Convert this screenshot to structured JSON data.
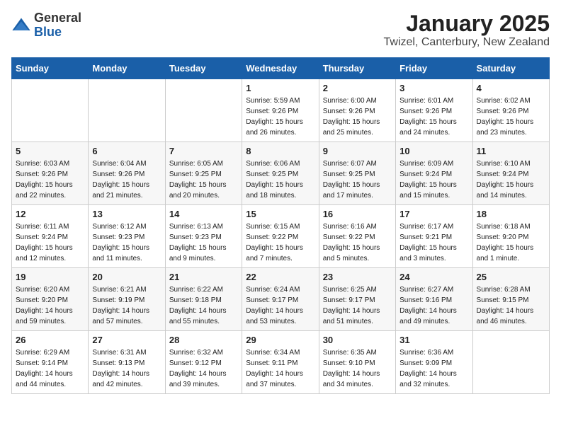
{
  "logo": {
    "general": "General",
    "blue": "Blue"
  },
  "title": "January 2025",
  "subtitle": "Twizel, Canterbury, New Zealand",
  "days_of_week": [
    "Sunday",
    "Monday",
    "Tuesday",
    "Wednesday",
    "Thursday",
    "Friday",
    "Saturday"
  ],
  "weeks": [
    [
      {
        "day": null,
        "sunrise": null,
        "sunset": null,
        "daylight": null
      },
      {
        "day": null,
        "sunrise": null,
        "sunset": null,
        "daylight": null
      },
      {
        "day": null,
        "sunrise": null,
        "sunset": null,
        "daylight": null
      },
      {
        "day": "1",
        "sunrise": "5:59 AM",
        "sunset": "9:26 PM",
        "daylight": "15 hours and 26 minutes."
      },
      {
        "day": "2",
        "sunrise": "6:00 AM",
        "sunset": "9:26 PM",
        "daylight": "15 hours and 25 minutes."
      },
      {
        "day": "3",
        "sunrise": "6:01 AM",
        "sunset": "9:26 PM",
        "daylight": "15 hours and 24 minutes."
      },
      {
        "day": "4",
        "sunrise": "6:02 AM",
        "sunset": "9:26 PM",
        "daylight": "15 hours and 23 minutes."
      }
    ],
    [
      {
        "day": "5",
        "sunrise": "6:03 AM",
        "sunset": "9:26 PM",
        "daylight": "15 hours and 22 minutes."
      },
      {
        "day": "6",
        "sunrise": "6:04 AM",
        "sunset": "9:26 PM",
        "daylight": "15 hours and 21 minutes."
      },
      {
        "day": "7",
        "sunrise": "6:05 AM",
        "sunset": "9:25 PM",
        "daylight": "15 hours and 20 minutes."
      },
      {
        "day": "8",
        "sunrise": "6:06 AM",
        "sunset": "9:25 PM",
        "daylight": "15 hours and 18 minutes."
      },
      {
        "day": "9",
        "sunrise": "6:07 AM",
        "sunset": "9:25 PM",
        "daylight": "15 hours and 17 minutes."
      },
      {
        "day": "10",
        "sunrise": "6:09 AM",
        "sunset": "9:24 PM",
        "daylight": "15 hours and 15 minutes."
      },
      {
        "day": "11",
        "sunrise": "6:10 AM",
        "sunset": "9:24 PM",
        "daylight": "15 hours and 14 minutes."
      }
    ],
    [
      {
        "day": "12",
        "sunrise": "6:11 AM",
        "sunset": "9:24 PM",
        "daylight": "15 hours and 12 minutes."
      },
      {
        "day": "13",
        "sunrise": "6:12 AM",
        "sunset": "9:23 PM",
        "daylight": "15 hours and 11 minutes."
      },
      {
        "day": "14",
        "sunrise": "6:13 AM",
        "sunset": "9:23 PM",
        "daylight": "15 hours and 9 minutes."
      },
      {
        "day": "15",
        "sunrise": "6:15 AM",
        "sunset": "9:22 PM",
        "daylight": "15 hours and 7 minutes."
      },
      {
        "day": "16",
        "sunrise": "6:16 AM",
        "sunset": "9:22 PM",
        "daylight": "15 hours and 5 minutes."
      },
      {
        "day": "17",
        "sunrise": "6:17 AM",
        "sunset": "9:21 PM",
        "daylight": "15 hours and 3 minutes."
      },
      {
        "day": "18",
        "sunrise": "6:18 AM",
        "sunset": "9:20 PM",
        "daylight": "15 hours and 1 minute."
      }
    ],
    [
      {
        "day": "19",
        "sunrise": "6:20 AM",
        "sunset": "9:20 PM",
        "daylight": "14 hours and 59 minutes."
      },
      {
        "day": "20",
        "sunrise": "6:21 AM",
        "sunset": "9:19 PM",
        "daylight": "14 hours and 57 minutes."
      },
      {
        "day": "21",
        "sunrise": "6:22 AM",
        "sunset": "9:18 PM",
        "daylight": "14 hours and 55 minutes."
      },
      {
        "day": "22",
        "sunrise": "6:24 AM",
        "sunset": "9:17 PM",
        "daylight": "14 hours and 53 minutes."
      },
      {
        "day": "23",
        "sunrise": "6:25 AM",
        "sunset": "9:17 PM",
        "daylight": "14 hours and 51 minutes."
      },
      {
        "day": "24",
        "sunrise": "6:27 AM",
        "sunset": "9:16 PM",
        "daylight": "14 hours and 49 minutes."
      },
      {
        "day": "25",
        "sunrise": "6:28 AM",
        "sunset": "9:15 PM",
        "daylight": "14 hours and 46 minutes."
      }
    ],
    [
      {
        "day": "26",
        "sunrise": "6:29 AM",
        "sunset": "9:14 PM",
        "daylight": "14 hours and 44 minutes."
      },
      {
        "day": "27",
        "sunrise": "6:31 AM",
        "sunset": "9:13 PM",
        "daylight": "14 hours and 42 minutes."
      },
      {
        "day": "28",
        "sunrise": "6:32 AM",
        "sunset": "9:12 PM",
        "daylight": "14 hours and 39 minutes."
      },
      {
        "day": "29",
        "sunrise": "6:34 AM",
        "sunset": "9:11 PM",
        "daylight": "14 hours and 37 minutes."
      },
      {
        "day": "30",
        "sunrise": "6:35 AM",
        "sunset": "9:10 PM",
        "daylight": "14 hours and 34 minutes."
      },
      {
        "day": "31",
        "sunrise": "6:36 AM",
        "sunset": "9:09 PM",
        "daylight": "14 hours and 32 minutes."
      },
      {
        "day": null,
        "sunrise": null,
        "sunset": null,
        "daylight": null
      }
    ]
  ],
  "labels": {
    "sunrise_prefix": "Sunrise: ",
    "sunset_prefix": "Sunset: ",
    "daylight_prefix": "Daylight: "
  }
}
